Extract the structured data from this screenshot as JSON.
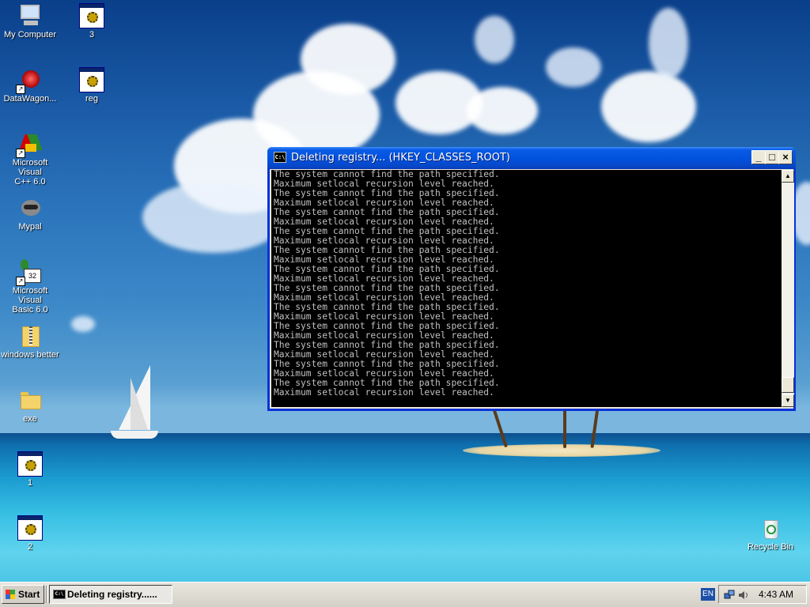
{
  "desktop": {
    "icons": [
      {
        "label": "My Computer"
      },
      {
        "label": "3"
      },
      {
        "label": "DataWagon..."
      },
      {
        "label": "reg"
      },
      {
        "label_line1": "Microsoft Visual",
        "label_line2": "C++ 6.0"
      },
      {
        "label": "Mypal"
      },
      {
        "label_line1": "Microsoft Visual",
        "label_line2": "Basic 6.0"
      },
      {
        "label": "windows better"
      },
      {
        "label": "exe"
      },
      {
        "label": "1"
      },
      {
        "label": "2"
      },
      {
        "label": "Recycle Bin"
      }
    ]
  },
  "console": {
    "title": "Deleting registry... (HKEY_CLASSES_ROOT)",
    "icon_text": "C:\\",
    "minimize": "_",
    "maximize": "□",
    "close": "×",
    "scroll_up": "▲",
    "scroll_down": "▼",
    "lines": [
      "The system cannot find the path specified.",
      "Maximum setlocal recursion level reached.",
      "The system cannot find the path specified.",
      "Maximum setlocal recursion level reached.",
      "The system cannot find the path specified.",
      "Maximum setlocal recursion level reached.",
      "The system cannot find the path specified.",
      "Maximum setlocal recursion level reached.",
      "The system cannot find the path specified.",
      "Maximum setlocal recursion level reached.",
      "The system cannot find the path specified.",
      "Maximum setlocal recursion level reached.",
      "The system cannot find the path specified.",
      "Maximum setlocal recursion level reached.",
      "The system cannot find the path specified.",
      "Maximum setlocal recursion level reached.",
      "The system cannot find the path specified.",
      "Maximum setlocal recursion level reached.",
      "The system cannot find the path specified.",
      "Maximum setlocal recursion level reached.",
      "The system cannot find the path specified.",
      "Maximum setlocal recursion level reached.",
      "The system cannot find the path specified.",
      "Maximum setlocal recursion level reached."
    ]
  },
  "taskbar": {
    "start_label": "Start",
    "task_label": "Deleting registry......",
    "task_icon_text": "C:\\",
    "language": "EN",
    "clock": "4:43 AM"
  },
  "icons": [
    "computer-icon",
    "application-icon",
    "folder-icon",
    "zip-folder-icon",
    "recycle-bin-icon",
    "console-icon",
    "windows-flag-icon",
    "network-icon",
    "sound-icon"
  ],
  "colors": {
    "titlebar_blue": "#0253e0",
    "console_bg": "#000000",
    "console_text": "#c0c0c0",
    "taskbar_gray": "#d4d0c8"
  }
}
